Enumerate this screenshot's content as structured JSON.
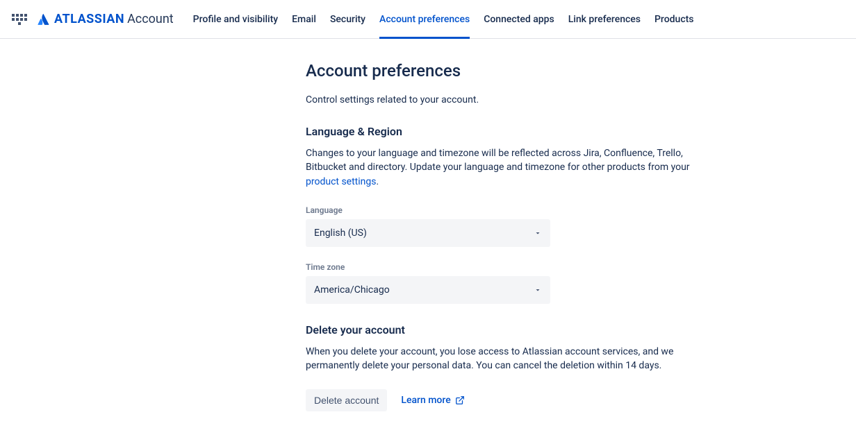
{
  "brand": {
    "name": "ATLASSIAN",
    "suffix": "Account"
  },
  "nav": {
    "items": [
      {
        "label": "Profile and visibility",
        "active": false
      },
      {
        "label": "Email",
        "active": false
      },
      {
        "label": "Security",
        "active": false
      },
      {
        "label": "Account preferences",
        "active": true
      },
      {
        "label": "Connected apps",
        "active": false
      },
      {
        "label": "Link preferences",
        "active": false
      },
      {
        "label": "Products",
        "active": false
      }
    ]
  },
  "page": {
    "title": "Account preferences",
    "description": "Control settings related to your account."
  },
  "languageRegion": {
    "title": "Language & Region",
    "description_part1": "Changes to your language and timezone will be reflected across Jira, Confluence, Trello, Bitbucket and directory. Update your language and timezone for other products from your ",
    "link_text": "product settings",
    "description_part2": ".",
    "language_label": "Language",
    "language_value": "English (US)",
    "timezone_label": "Time zone",
    "timezone_value": "America/Chicago"
  },
  "deleteAccount": {
    "title": "Delete your account",
    "description": "When you delete your account, you lose access to Atlassian account services, and we permanently delete your personal data. You can cancel the deletion within 14 days.",
    "delete_button": "Delete account",
    "learn_more": "Learn more"
  }
}
